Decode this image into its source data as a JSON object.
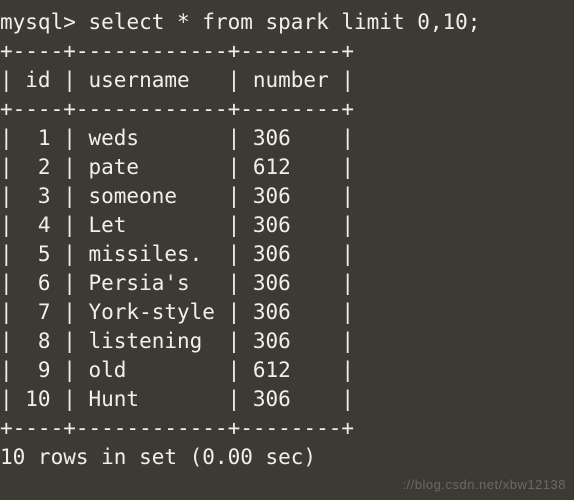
{
  "prompt": "mysql>",
  "query": "select * from spark limit 0,10;",
  "table": {
    "border": "+----+------------+--------+",
    "header": "| id | username   | number |",
    "rows": [
      "|  1 | weds       | 306    |",
      "|  2 | pate       | 612    |",
      "|  3 | someone    | 306    |",
      "|  4 | Let        | 306    |",
      "|  5 | missiles.  | 306    |",
      "|  6 | Persia's   | 306    |",
      "|  7 | York-style | 306    |",
      "|  8 | listening  | 306    |",
      "|  9 | old        | 612    |",
      "| 10 | Hunt       | 306    |"
    ],
    "columns": [
      "id",
      "username",
      "number"
    ],
    "data": [
      {
        "id": 1,
        "username": "weds",
        "number": 306
      },
      {
        "id": 2,
        "username": "pate",
        "number": 612
      },
      {
        "id": 3,
        "username": "someone",
        "number": 306
      },
      {
        "id": 4,
        "username": "Let",
        "number": 306
      },
      {
        "id": 5,
        "username": "missiles.",
        "number": 306
      },
      {
        "id": 6,
        "username": "Persia's",
        "number": 306
      },
      {
        "id": 7,
        "username": "York-style",
        "number": 306
      },
      {
        "id": 8,
        "username": "listening",
        "number": 306
      },
      {
        "id": 9,
        "username": "old",
        "number": 612
      },
      {
        "id": 10,
        "username": "Hunt",
        "number": 306
      }
    ]
  },
  "summary": "10 rows in set (0.00 sec)",
  "watermark": "://blog.csdn.net/xbw12138"
}
